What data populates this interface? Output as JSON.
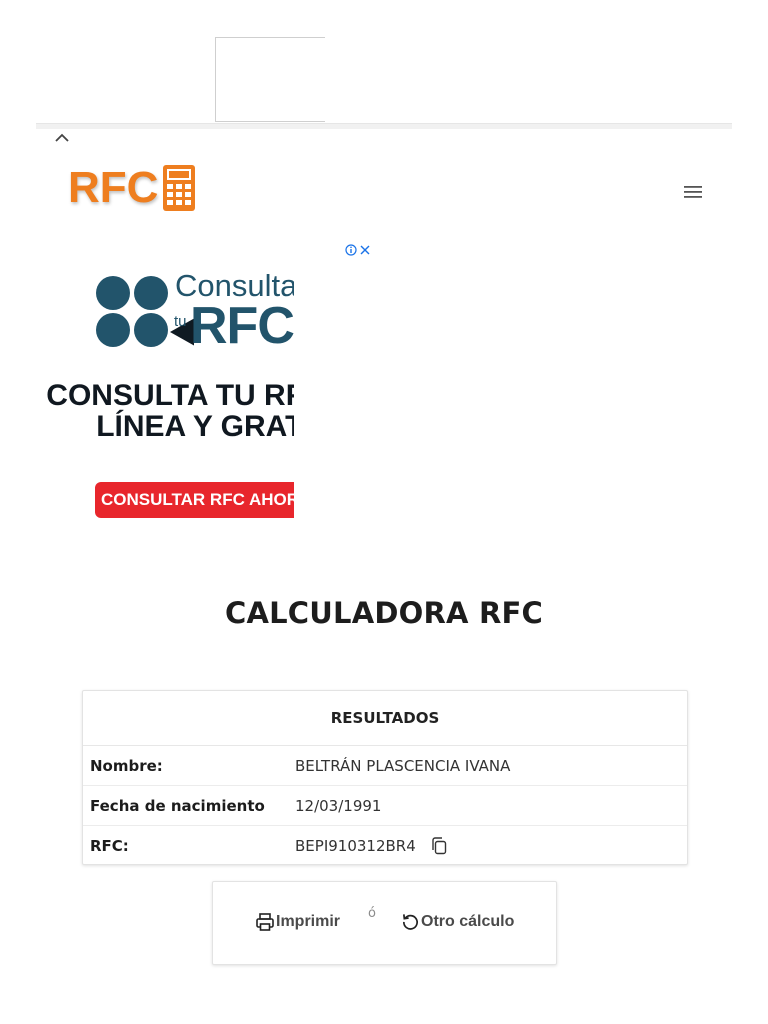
{
  "header": {
    "logo_text": "RFC",
    "logo_icon": "calculator-icon",
    "menu_icon": "hamburger-menu-icon"
  },
  "ad": {
    "logo_word_top": "Consulta",
    "logo_word_small": "tu",
    "logo_word_main": "RFC",
    "headline_line1": "CONSULTA TU RFC EN",
    "headline_line2": "LÍNEA Y GRATIS",
    "cta": "CONSULTAR RFC AHORA",
    "info_icon": "info-icon",
    "close_icon": "close-icon"
  },
  "main": {
    "title": "CALCULADORA RFC",
    "results": {
      "header": "RESULTADOS",
      "rows": [
        {
          "label": "Nombre:",
          "value": "BELTRÁN PLASCENCIA IVANA"
        },
        {
          "label": "Fecha de nacimiento",
          "value": "12/03/1991"
        },
        {
          "label": "RFC:",
          "value": "BEPI910312BR4"
        }
      ]
    },
    "actions": {
      "print_label": "Imprimir",
      "separator": "ó",
      "again_label": "Otro cálculo"
    }
  },
  "colors": {
    "brand_orange": "#ee7e1f",
    "ad_blue": "#22546b",
    "ad_red": "#e8262c",
    "ad_info_blue": "#1a73e8"
  }
}
